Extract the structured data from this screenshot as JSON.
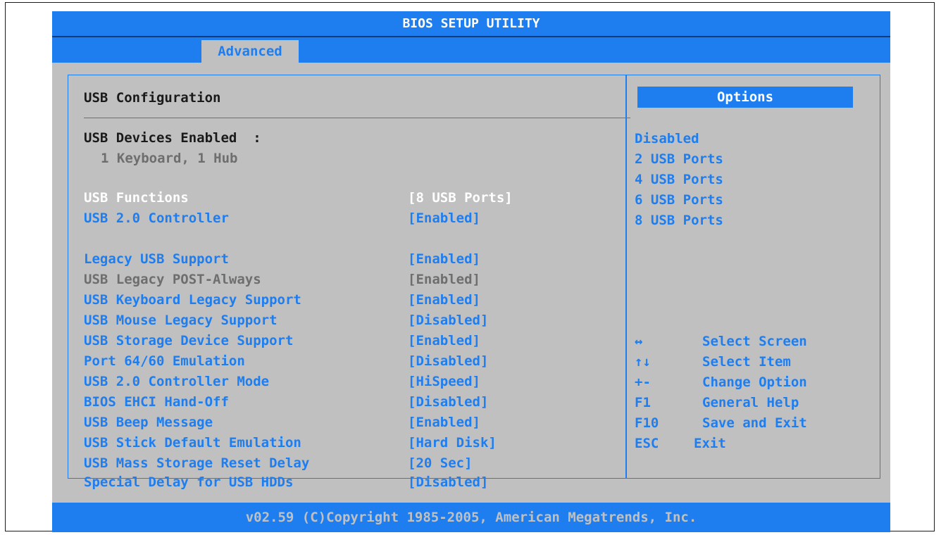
{
  "title": "BIOS SETUP UTILITY",
  "tabs": [
    {
      "label": "Advanced",
      "active": true
    }
  ],
  "main": {
    "heading": "USB Configuration",
    "devices_label": "USB Devices Enabled  :",
    "devices_value": "1 Keyboard, 1 Hub",
    "settings": [
      {
        "label": "USB Functions",
        "value": "[8 USB Ports]",
        "state": "selected"
      },
      {
        "label": "USB 2.0 Controller",
        "value": "[Enabled]",
        "state": "normal"
      },
      {
        "label": "Legacy USB Support",
        "value": "[Enabled]",
        "state": "normal"
      },
      {
        "label": "USB Legacy POST-Always",
        "value": "[Enabled]",
        "state": "disabled"
      },
      {
        "label": "USB Keyboard Legacy Support",
        "value": "[Enabled]",
        "state": "normal"
      },
      {
        "label": "USB Mouse Legacy Support",
        "value": "[Disabled]",
        "state": "normal"
      },
      {
        "label": "USB Storage Device Support",
        "value": "[Enabled]",
        "state": "normal"
      },
      {
        "label": "Port 64/60 Emulation",
        "value": "[Disabled]",
        "state": "normal"
      },
      {
        "label": "USB 2.0 Controller Mode",
        "value": "[HiSpeed]",
        "state": "normal"
      },
      {
        "label": "BIOS EHCI Hand-Off",
        "value": "[Disabled]",
        "state": "normal"
      },
      {
        "label": "USB Beep Message",
        "value": "[Enabled]",
        "state": "normal"
      },
      {
        "label": "USB Stick Default Emulation",
        "value": "[Hard Disk]",
        "state": "normal"
      },
      {
        "label": "USB Mass Storage Reset Delay",
        "value": "[20 Sec]",
        "state": "normal"
      },
      {
        "label": "Special Delay for USB HDDs",
        "value": "[Disabled]",
        "state": "normal"
      }
    ]
  },
  "options": {
    "header": "Options",
    "items": [
      "Disabled",
      "2 USB Ports",
      "4 USB Ports",
      "6 USB Ports",
      "8 USB Ports"
    ]
  },
  "help": [
    {
      "key": "↔",
      "key_icon": "left-right-arrow-icon",
      "desc": "Select Screen"
    },
    {
      "key": "↑↓",
      "key_icon": "up-down-arrow-icon",
      "desc": "Select Item"
    },
    {
      "key": "+-",
      "desc": "Change Option"
    },
    {
      "key": "F1",
      "desc": "General Help"
    },
    {
      "key": "F10",
      "desc": "Save and Exit"
    },
    {
      "key": "ESC",
      "desc": "Exit"
    }
  ],
  "footer": "v02.59 (C)Copyright 1985-2005, American Megatrends, Inc.",
  "colors": {
    "accent": "#1e7ef0",
    "panel": "#c0c0c0",
    "disabled": "#6e6e6e",
    "selected": "#ffffff"
  }
}
